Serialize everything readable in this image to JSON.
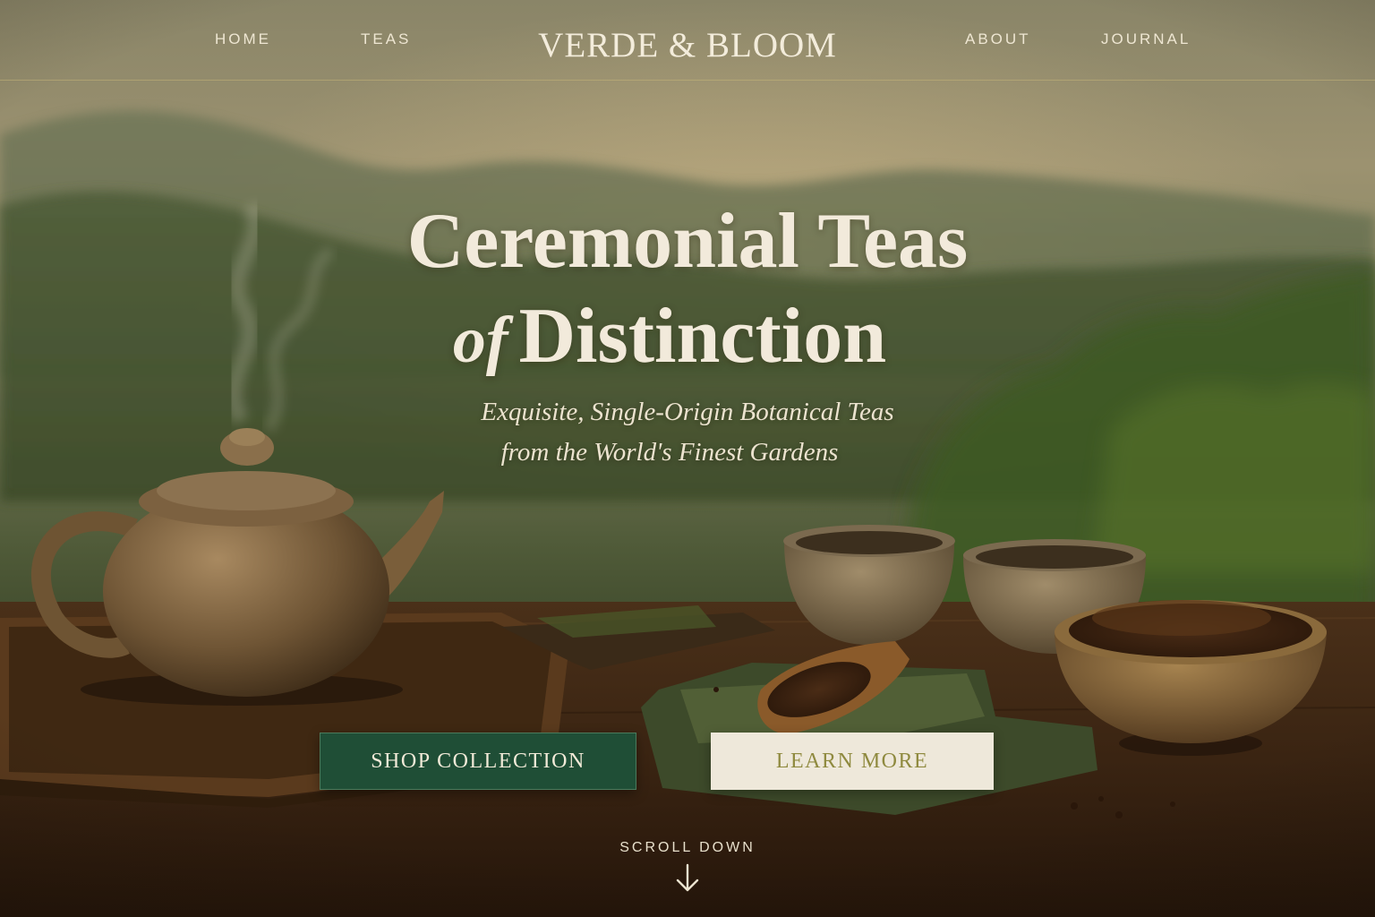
{
  "nav": {
    "home": "HOME",
    "teas": "TEAS",
    "brand": "VERDE & BLOOM",
    "about": "ABOUT",
    "journal": "JOURNAL"
  },
  "hero": {
    "title_line1": "Ceremonial Teas",
    "title_of": "of",
    "title_line2": "Distinction",
    "subtitle_line1": "Exquisite, Single-Origin Botanical Teas",
    "subtitle_line2": "from the World's Finest Gardens"
  },
  "buttons": {
    "shop": "SHOP COLLECTION",
    "learn": "LEARN MORE"
  },
  "scroll": {
    "label": "SCROLL DOWN",
    "icon": "arrow-down-icon"
  },
  "colors": {
    "primary_button": "#1f4e36",
    "secondary_button": "#eee8da",
    "secondary_text": "#8f8a3f",
    "nav_rule": "#c4b478"
  }
}
